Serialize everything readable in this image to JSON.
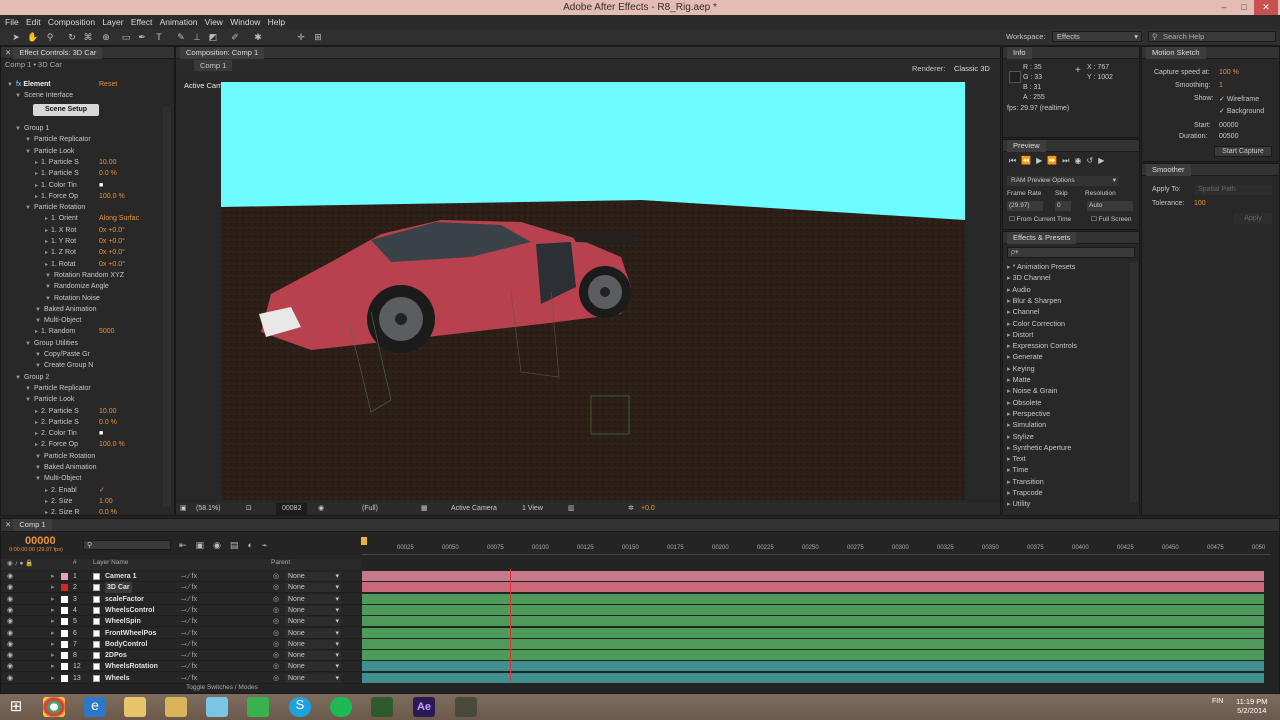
{
  "window": {
    "title": "Adobe After Effects - R8_Rig.aep *"
  },
  "menu": [
    "File",
    "Edit",
    "Composition",
    "Layer",
    "Effect",
    "Animation",
    "View",
    "Window",
    "Help"
  ],
  "workspace": {
    "label": "Workspace:",
    "value": "Effects"
  },
  "search_help": {
    "placeholder": "Search Help"
  },
  "effect_controls": {
    "tab": "Effect Controls: 3D Car",
    "breadcrumb": "Comp 1 • 3D Car",
    "element_label": "Element",
    "reset": "Reset",
    "scene_interface": "Scene Interface",
    "scene_setup": "Scene Setup",
    "rows": [
      {
        "t": "Group 1",
        "i": 1,
        "v": ""
      },
      {
        "t": "Particle Replicator",
        "i": 2,
        "v": ""
      },
      {
        "t": "Particle Look",
        "i": 2,
        "v": ""
      },
      {
        "t": "1. Particle S",
        "i": 3,
        "v": "10.00"
      },
      {
        "t": "1. Particle S",
        "i": 3,
        "v": "0.0 %"
      },
      {
        "t": "1. Color Tin",
        "i": 3,
        "v": "■"
      },
      {
        "t": "1. Force Op",
        "i": 3,
        "v": "100.0 %"
      },
      {
        "t": "Particle Rotation",
        "i": 2,
        "v": ""
      },
      {
        "t": "1. Orient",
        "i": 4,
        "v": "Along Surfac"
      },
      {
        "t": "1. X Rot",
        "i": 4,
        "v": "0x +0.0°"
      },
      {
        "t": "1. Y Rot",
        "i": 4,
        "v": "0x +0.0°"
      },
      {
        "t": "1. Z Rot",
        "i": 4,
        "v": "0x +0.0°"
      },
      {
        "t": "1. Rotat",
        "i": 4,
        "v": "0x +0.0°"
      },
      {
        "t": "Rotation Random XYZ",
        "i": 4,
        "v": ""
      },
      {
        "t": "Randomize Angle",
        "i": 4,
        "v": ""
      },
      {
        "t": "Rotation Noise",
        "i": 4,
        "v": ""
      },
      {
        "t": "Baked Animation",
        "i": 3,
        "v": ""
      },
      {
        "t": "Multi-Object",
        "i": 3,
        "v": ""
      },
      {
        "t": "1. Random",
        "i": 3,
        "v": "5000"
      },
      {
        "t": "Group Utilities",
        "i": 2,
        "v": ""
      },
      {
        "t": "Copy/Paste Gr",
        "i": 3,
        "v": ""
      },
      {
        "t": "Create Group N",
        "i": 3,
        "v": ""
      },
      {
        "t": "Group 2",
        "i": 1,
        "v": ""
      },
      {
        "t": "Particle Replicator",
        "i": 2,
        "v": ""
      },
      {
        "t": "Particle Look",
        "i": 2,
        "v": ""
      },
      {
        "t": "2. Particle S",
        "i": 3,
        "v": "10.00"
      },
      {
        "t": "2. Particle S",
        "i": 3,
        "v": "0.0 %"
      },
      {
        "t": "2. Color Tin",
        "i": 3,
        "v": "■"
      },
      {
        "t": "2. Force Op",
        "i": 3,
        "v": "100.0 %"
      },
      {
        "t": "Particle Rotation",
        "i": 3,
        "v": ""
      },
      {
        "t": "Baked Animation",
        "i": 3,
        "v": ""
      },
      {
        "t": "Multi-Object",
        "i": 3,
        "v": ""
      },
      {
        "t": "2. Enabl",
        "i": 4,
        "v": "✓"
      },
      {
        "t": "2. Size",
        "i": 4,
        "v": "1.00"
      },
      {
        "t": "2. Size R",
        "i": 4,
        "v": "0.0 %"
      }
    ]
  },
  "composition": {
    "tab": "Composition: Comp 1",
    "sub_tab": "Comp 1",
    "renderer_label": "Renderer:",
    "renderer": "Classic 3D",
    "active_camera": "Active Camera",
    "footer": {
      "zoom": "(58.1%)",
      "frame": "00082",
      "quality": "(Full)",
      "camera": "Active Camera",
      "views": "1 View",
      "exposure": "+0.0"
    }
  },
  "info": {
    "tab": "Info",
    "r": "R : 35",
    "g": "G : 33",
    "b": "B : 31",
    "a": "A : 255",
    "x": "X : 767",
    "y": "Y : 1002",
    "fps": "fps: 29.97 (realtime)"
  },
  "preview": {
    "tab": "Preview",
    "ram": "RAM Preview Options",
    "frame_rate": "Frame Rate",
    "skip": "Skip",
    "resolution": "Resolution",
    "fr_val": "(29.97)",
    "skip_val": "0",
    "res_val": "Auto",
    "from_current": "From Current Time",
    "full_screen": "Full Screen"
  },
  "effects_presets": {
    "tab": "Effects & Presets",
    "search_placeholder": "ρ▾",
    "items": [
      "* Animation Presets",
      "3D Channel",
      "Audio",
      "Blur & Sharpen",
      "Channel",
      "Color Correction",
      "Distort",
      "Expression Controls",
      "Generate",
      "Keying",
      "Matte",
      "Noise & Grain",
      "Obsolete",
      "Perspective",
      "Simulation",
      "Stylize",
      "Synthetic Aperture",
      "Text",
      "Time",
      "Transition",
      "Trapcode",
      "Utility"
    ]
  },
  "motion_sketch": {
    "tab": "Motion Sketch",
    "capture_label": "Capture speed at:",
    "capture": "100 %",
    "smoothing_label": "Smoothing:",
    "smoothing": "1",
    "show_label": "Show:",
    "wireframe": "Wireframe",
    "background": "Background",
    "start_label": "Start:",
    "start": "00000",
    "duration_label": "Duration:",
    "duration": "00500",
    "start_capture": "Start Capture"
  },
  "smoother": {
    "tab": "Smoother",
    "apply_to_label": "Apply To:",
    "apply_to": "Spatial Path",
    "tolerance_label": "Tolerance:",
    "tolerance": "100",
    "apply": "Apply"
  },
  "timeline": {
    "tab": "Comp 1",
    "timecode": "00000",
    "timecode_sub": "0:00:00:00 (29.97 fps)",
    "col_layer": "Layer Name",
    "col_parent": "Parent",
    "col_num": "#",
    "ruler": [
      "00025",
      "00050",
      "00075",
      "00100",
      "00125",
      "00150",
      "00175",
      "00200",
      "00225",
      "00250",
      "00275",
      "00300",
      "00325",
      "00350",
      "00375",
      "00400",
      "00425",
      "00450",
      "00475",
      "0050"
    ],
    "layers": [
      {
        "n": "1",
        "name": "Camera 1",
        "parent": "None",
        "color": "#e6a3b5",
        "bar": "#c77a8b"
      },
      {
        "n": "2",
        "name": "3D Car",
        "parent": "None",
        "color": "#d22",
        "bar": "#c96a7a"
      },
      {
        "n": "3",
        "name": "scaleFactor",
        "parent": "None",
        "color": "#fff",
        "bar": "#4e9a5a"
      },
      {
        "n": "4",
        "name": "WheelsControl",
        "parent": "None",
        "color": "#fff",
        "bar": "#4e9a5a"
      },
      {
        "n": "5",
        "name": "WheelSpin",
        "parent": "None",
        "color": "#fff",
        "bar": "#4e9a5a"
      },
      {
        "n": "6",
        "name": "FrontWheelPos",
        "parent": "None",
        "color": "#fff",
        "bar": "#4e9a5a"
      },
      {
        "n": "7",
        "name": "BodyControl",
        "parent": "None",
        "color": "#fff",
        "bar": "#4e9a5a"
      },
      {
        "n": "8",
        "name": "2DPos",
        "parent": "None",
        "color": "#fff",
        "bar": "#4e9a5a"
      },
      {
        "n": "12",
        "name": "WheelsRotation",
        "parent": "None",
        "color": "#fff",
        "bar": "#3f8f8f"
      },
      {
        "n": "13",
        "name": "Wheels",
        "parent": "None",
        "color": "#fff",
        "bar": "#3f8f8f"
      }
    ],
    "toggle": "Toggle Switches / Modes"
  },
  "taskbar": {
    "time": "11:19 PM",
    "date": "5/2/2014",
    "lang": "FIN"
  }
}
